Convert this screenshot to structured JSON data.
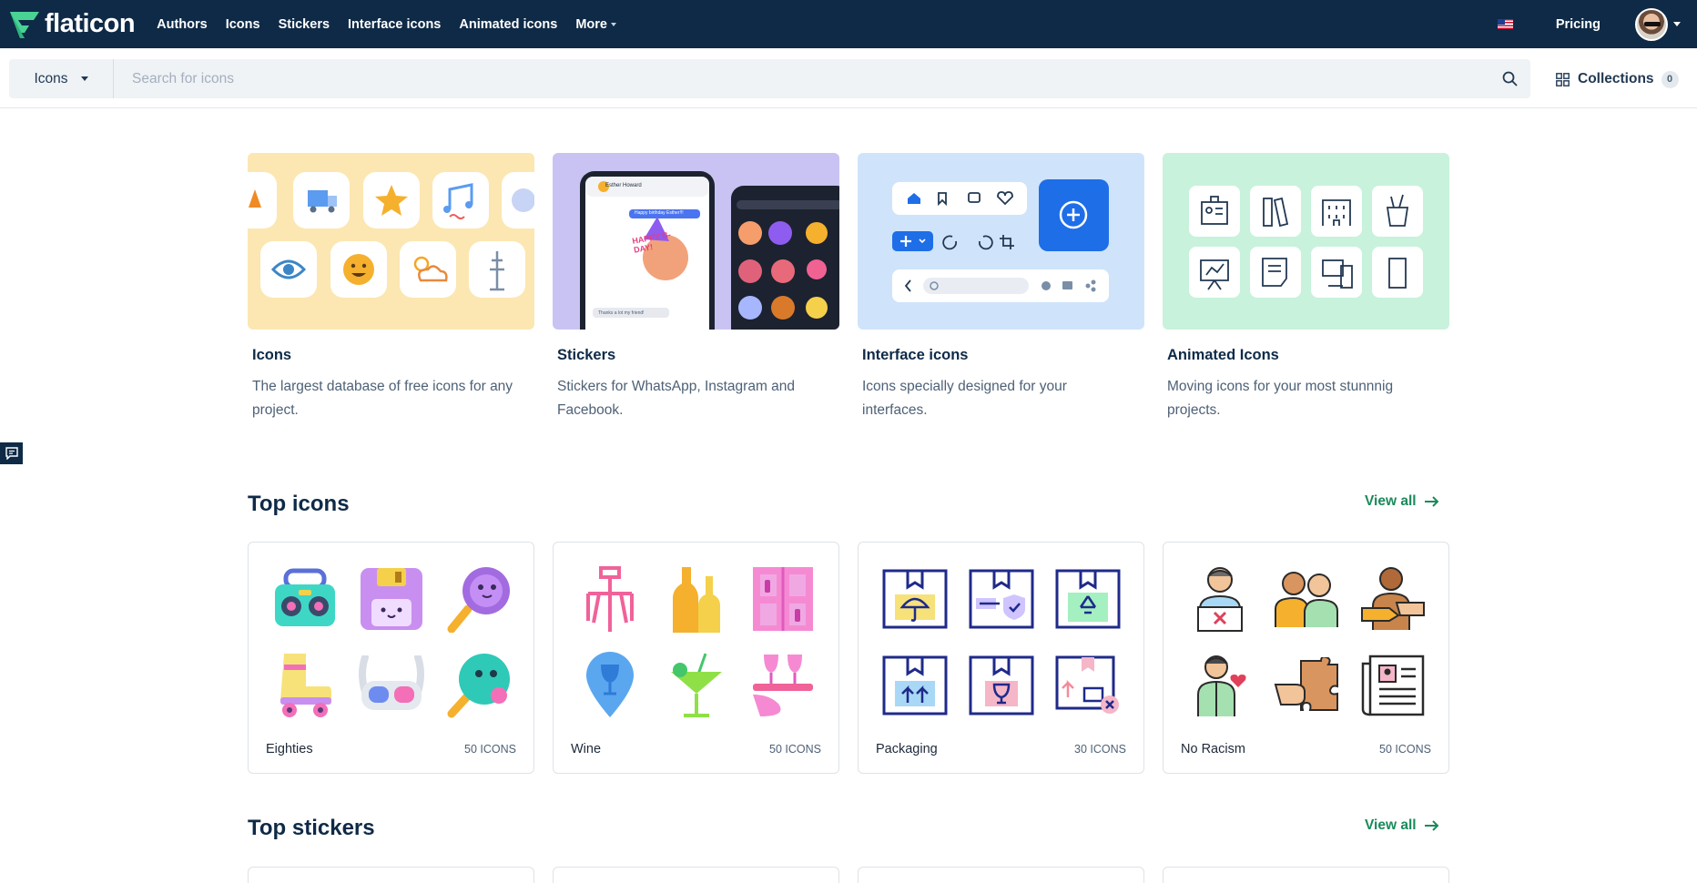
{
  "brand": {
    "name": "flaticon"
  },
  "nav": {
    "links": [
      {
        "label": "Authors"
      },
      {
        "label": "Icons"
      },
      {
        "label": "Stickers"
      },
      {
        "label": "Interface icons"
      },
      {
        "label": "Animated icons"
      },
      {
        "label": "More"
      }
    ],
    "pricing": "Pricing",
    "language_flag": "us-flag-icon"
  },
  "search": {
    "type_selected": "Icons",
    "placeholder": "Search for icons"
  },
  "collections": {
    "label": "Collections",
    "count": "0"
  },
  "categories": [
    {
      "title": "Icons",
      "description": "The largest database of free icons for any project."
    },
    {
      "title": "Stickers",
      "description": "Stickers for WhatsApp, Instagram and Facebook."
    },
    {
      "title": "Interface icons",
      "description": "Icons specially designed for your interfaces."
    },
    {
      "title": "Animated Icons",
      "description": "Moving icons for your most stunnnig projects."
    }
  ],
  "sticker_preview": {
    "contact": "Esther Howard",
    "bubble": "Happy birthday Esther!!!",
    "sticker_text": "HAPPY B-DAY!",
    "reply": "Thanks a lot my friend!"
  },
  "top_icons": {
    "title": "Top icons",
    "view_all": "View all",
    "packs": [
      {
        "name": "Eighties",
        "count": "50 ICONS"
      },
      {
        "name": "Wine",
        "count": "50 ICONS"
      },
      {
        "name": "Packaging",
        "count": "30 ICONS"
      },
      {
        "name": "No Racism",
        "count": "50 ICONS"
      }
    ]
  },
  "top_stickers": {
    "title": "Top stickers",
    "view_all": "View all"
  },
  "colors": {
    "nav_bg": "#0e2a47",
    "accent_green": "#1a8a5b",
    "icons_bg": "#fce7b2",
    "stickers_bg": "#c9c3f3",
    "interface_bg": "#cfe4fb",
    "animated_bg": "#c8f2dc"
  }
}
